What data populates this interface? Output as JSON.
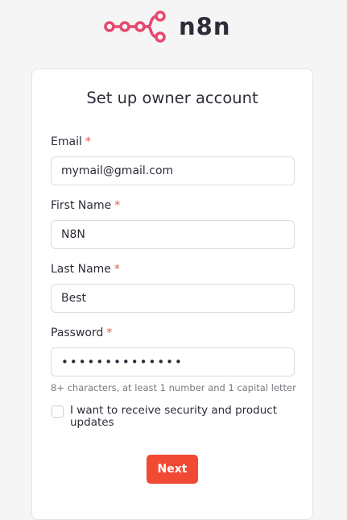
{
  "brand": {
    "name": "n8n",
    "color": "#e6496f"
  },
  "form": {
    "title": "Set up owner account",
    "required_marker": "*",
    "fields": [
      {
        "label": "Email",
        "value": "mymail@gmail.com"
      },
      {
        "label": "First Name",
        "value": "N8N"
      },
      {
        "label": "Last Name",
        "value": "Best"
      },
      {
        "label": "Password",
        "value": "••••••••••••••"
      }
    ],
    "password_hint": "8+ characters, at least 1 number and 1 capital letter",
    "updates_checkbox": {
      "label": "I want to receive security and product updates",
      "checked": false
    },
    "next_label": "Next"
  },
  "colors": {
    "accent": "#f04a35",
    "required": "#f0523f",
    "background": "#f5f5f5"
  }
}
